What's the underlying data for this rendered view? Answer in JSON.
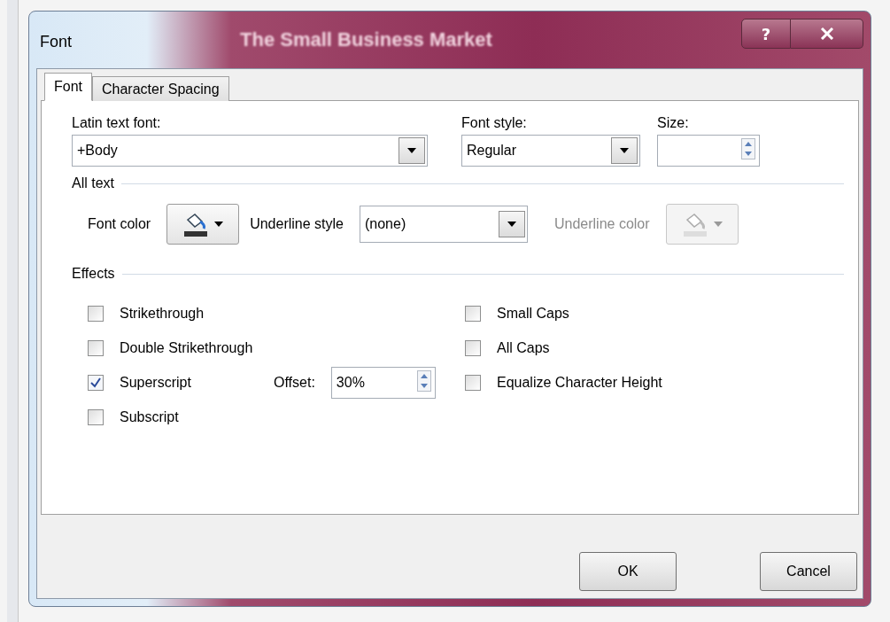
{
  "window": {
    "title": "Font",
    "background_heading": "The Small Business Market",
    "help_label": "?"
  },
  "tabs": [
    {
      "label": "Font",
      "selected": true
    },
    {
      "label": "Character Spacing",
      "selected": false
    }
  ],
  "latin_font": {
    "label": "Latin text font:",
    "value": "+Body"
  },
  "font_style": {
    "label": "Font style:",
    "value": "Regular"
  },
  "size": {
    "label": "Size:"
  },
  "all_text": {
    "heading": "All text",
    "font_color": {
      "label": "Font color"
    },
    "underline_style": {
      "label": "Underline style",
      "value": "(none)"
    },
    "underline_color": {
      "label": "Underline color",
      "disabled": true
    }
  },
  "effects": {
    "heading": "Effects",
    "left_options": [
      {
        "label": "Strikethrough",
        "checked": false
      },
      {
        "label": "Double Strikethrough",
        "checked": false
      },
      {
        "label": "Superscript",
        "checked": true
      },
      {
        "label": "Subscript",
        "checked": false
      }
    ],
    "right_options": [
      {
        "label": "Small Caps",
        "checked": false
      },
      {
        "label": "All Caps",
        "checked": false
      },
      {
        "label": "Equalize Character Height",
        "checked": false
      }
    ],
    "offset": {
      "label": "Offset:",
      "value": "30%"
    }
  },
  "buttons": [
    "OK",
    "Cancel"
  ]
}
